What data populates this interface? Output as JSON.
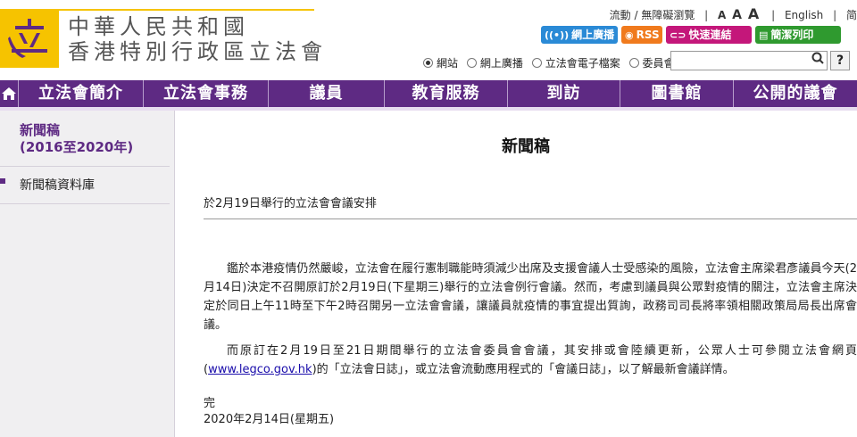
{
  "header": {
    "logo_line1": "中華人民共和國",
    "logo_line2": "香港特別行政區立法會",
    "top_links": {
      "mobile": "流動 / 無障礙瀏覽",
      "font_small": "A",
      "font_medium": "A",
      "font_large": "A",
      "english": "English",
      "extra": "简"
    },
    "buttons": {
      "live": "網上廣播",
      "rss": "RSS",
      "quick": "快速連結",
      "print": "簡潔列印"
    },
    "search_scopes": [
      "網站",
      "網上廣播",
      "立法會電子檔案",
      "委員會"
    ],
    "search_placeholder": "",
    "help": "?"
  },
  "nav": {
    "home_icon": "house-icon",
    "items": [
      "立法會簡介",
      "立法會事務",
      "議員",
      "教育服務",
      "到訪",
      "圖書館",
      "公開的議會"
    ]
  },
  "sidebar": {
    "title": "新聞稿\n(2016至2020年)",
    "title_line1": "新聞稿",
    "title_line2": "(2016至2020年)",
    "link": "新聞稿資料庫"
  },
  "main": {
    "title": "新聞稿",
    "subject": "於2月19日舉行的立法會會議安排",
    "para1": "鑑於本港疫情仍然嚴峻，立法會在履行憲制職能時須減少出席及支援會議人士受感染的風險，立法會主席梁君彥議員今天(2月14日)決定不召開原訂於2月19日(下星期三)舉行的立法會例行會議。然而，考慮到議員與公眾對疫情的關注，立法會主席決定於同日上午11時至下午2時召開另一立法會會議，讓議員就疫情的事宜提出質詢，政務司司長將率領相關政策局局長出席會議。",
    "para2_before": "而原訂在2月19日至21日期間舉行的立法會委員會會議，其安排或會陸續更新，公眾人士可參閱立法會網頁(",
    "para2_link": "www.legco.gov.hk",
    "para2_after": ")的「立法會日誌」，或立法會流動應用程式的「會議日誌」，以了解最新會議詳情。",
    "end": "完",
    "date": "2020年2月14日(星期五)"
  },
  "colors": {
    "nav_bg": "#5e2a83",
    "logo_yellow": "#f6c300",
    "live_btn": "#2a8ad6",
    "rss_btn": "#f07a1d",
    "quick_btn": "#c4177a",
    "print_btn": "#2f9a2f"
  }
}
